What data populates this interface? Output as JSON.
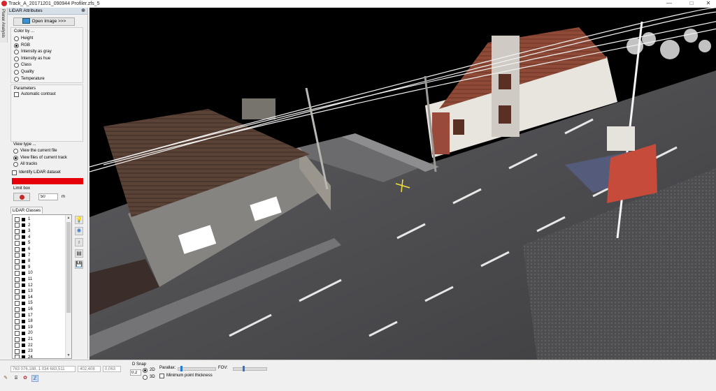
{
  "window": {
    "title": "Track_A_20171201_090944 Profiler.zfs_5",
    "minimize": "—",
    "maximize": "□",
    "close": "✕"
  },
  "side_tab": "Planar Analysis",
  "panel": {
    "title": "LiDAR Attributes",
    "pin": "⊕",
    "open_image": "Open Image >>>",
    "color_by": {
      "label": "Color by ...",
      "options": [
        "Height",
        "RGB",
        "Intensity as gray",
        "Intensity as hue",
        "Class",
        "Quality",
        "Temperature"
      ],
      "selected": "RGB"
    },
    "parameters": {
      "label": "Parameters",
      "auto_contrast": "Automatic contrast"
    },
    "view_type": {
      "label": "View type ...",
      "options": [
        "View the current file",
        "View files of current track",
        "All tracks"
      ],
      "selected": "View files of current track"
    },
    "identify": "Identify LiDAR dataset",
    "limit_box": {
      "label": "Limit box",
      "value": "50",
      "unit": "m"
    },
    "classes_tab": "LiDAR Classes",
    "classes": [
      "1",
      "2",
      "3",
      "4",
      "5",
      "6",
      "7",
      "8",
      "9",
      "10",
      "11",
      "12",
      "13",
      "14",
      "15",
      "16",
      "17",
      "18",
      "19",
      "20",
      "21",
      "22",
      "23",
      "24"
    ],
    "accent": "#e5000a"
  },
  "status": {
    "coords": "763 076,188, 1 034 683,511",
    "elevation": "402,408",
    "extra": "0,063",
    "dsnap": {
      "label": "D Snap",
      "value": "0.2",
      "options": [
        "2D",
        "3D"
      ],
      "selected": "2D"
    },
    "parallax": {
      "label": "Parallax:",
      "level": 0.05
    },
    "fov": {
      "label": "FOV:",
      "level": 0.3
    },
    "min_point": "Minimum point thickness"
  }
}
